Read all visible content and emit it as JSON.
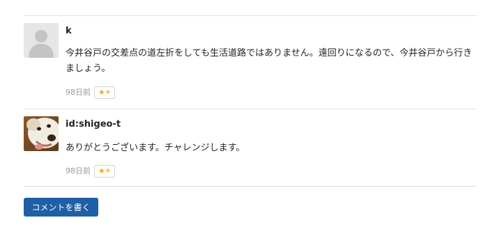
{
  "comments": [
    {
      "user": "k",
      "avatar": "default-user-silhouette",
      "text": "今井谷戸の交差点の道左折をしても生活道路ではありません。遠回りになるので、今井谷戸から行きましょう。",
      "time": "98日前",
      "star_icon": "★",
      "star_plus": "+"
    },
    {
      "user": "id:shigeo-t",
      "avatar": "dog-photo",
      "text": "ありがとうございます。チャレンジします。",
      "time": "98日前",
      "star_icon": "★",
      "star_plus": "+"
    }
  ],
  "write_comment_label": "コメントを書く",
  "colors": {
    "divider": "#dddddd",
    "button": "#1f5fa6",
    "star": "#f3a81d",
    "muted": "#999999"
  }
}
